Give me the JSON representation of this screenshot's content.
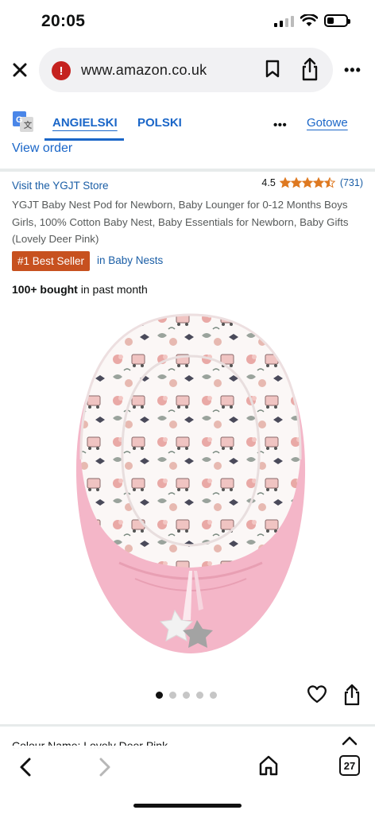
{
  "status_bar": {
    "time": "20:05"
  },
  "browser": {
    "url": "www.amazon.co.uk",
    "close_icon": "close-icon",
    "warning_icon": "insecure-warning-icon",
    "warning_glyph": "!",
    "more_label": "•••"
  },
  "translate": {
    "source_lang": "ANGIELSKI",
    "target_lang": "POLSKI",
    "more_label": "•••",
    "done_label": "Gotowe"
  },
  "nav": {
    "view_order": "View order"
  },
  "product": {
    "store_link": "Visit the YGJT Store",
    "rating_value": "4.5",
    "rating_stars": 4.5,
    "rating_count": "(731)",
    "title": "YGJT Baby Nest Pod for Newborn, Baby Lounger for 0-12 Months Boys Girls, 100% Cotton Baby Nest, Baby Essentials for Newborn, Baby Gifts (Lovely Deer Pink)",
    "badge": "#1 Best Seller",
    "badge_category": "in Baby Nests",
    "bought_bold": "100+ bought",
    "bought_rest": " in past month",
    "image_count": 5,
    "active_image": 1
  },
  "variation": {
    "partial_text": "Colour Name:  Lovely Deer Pink"
  },
  "toolbar": {
    "tab_count": "27"
  },
  "colors": {
    "link": "#1a5ea6",
    "translate_link": "#1a66c8",
    "badge": "#c7511f",
    "star": "#de7921",
    "nest_pink": "#f4b6c8",
    "warning": "#c5221f"
  }
}
